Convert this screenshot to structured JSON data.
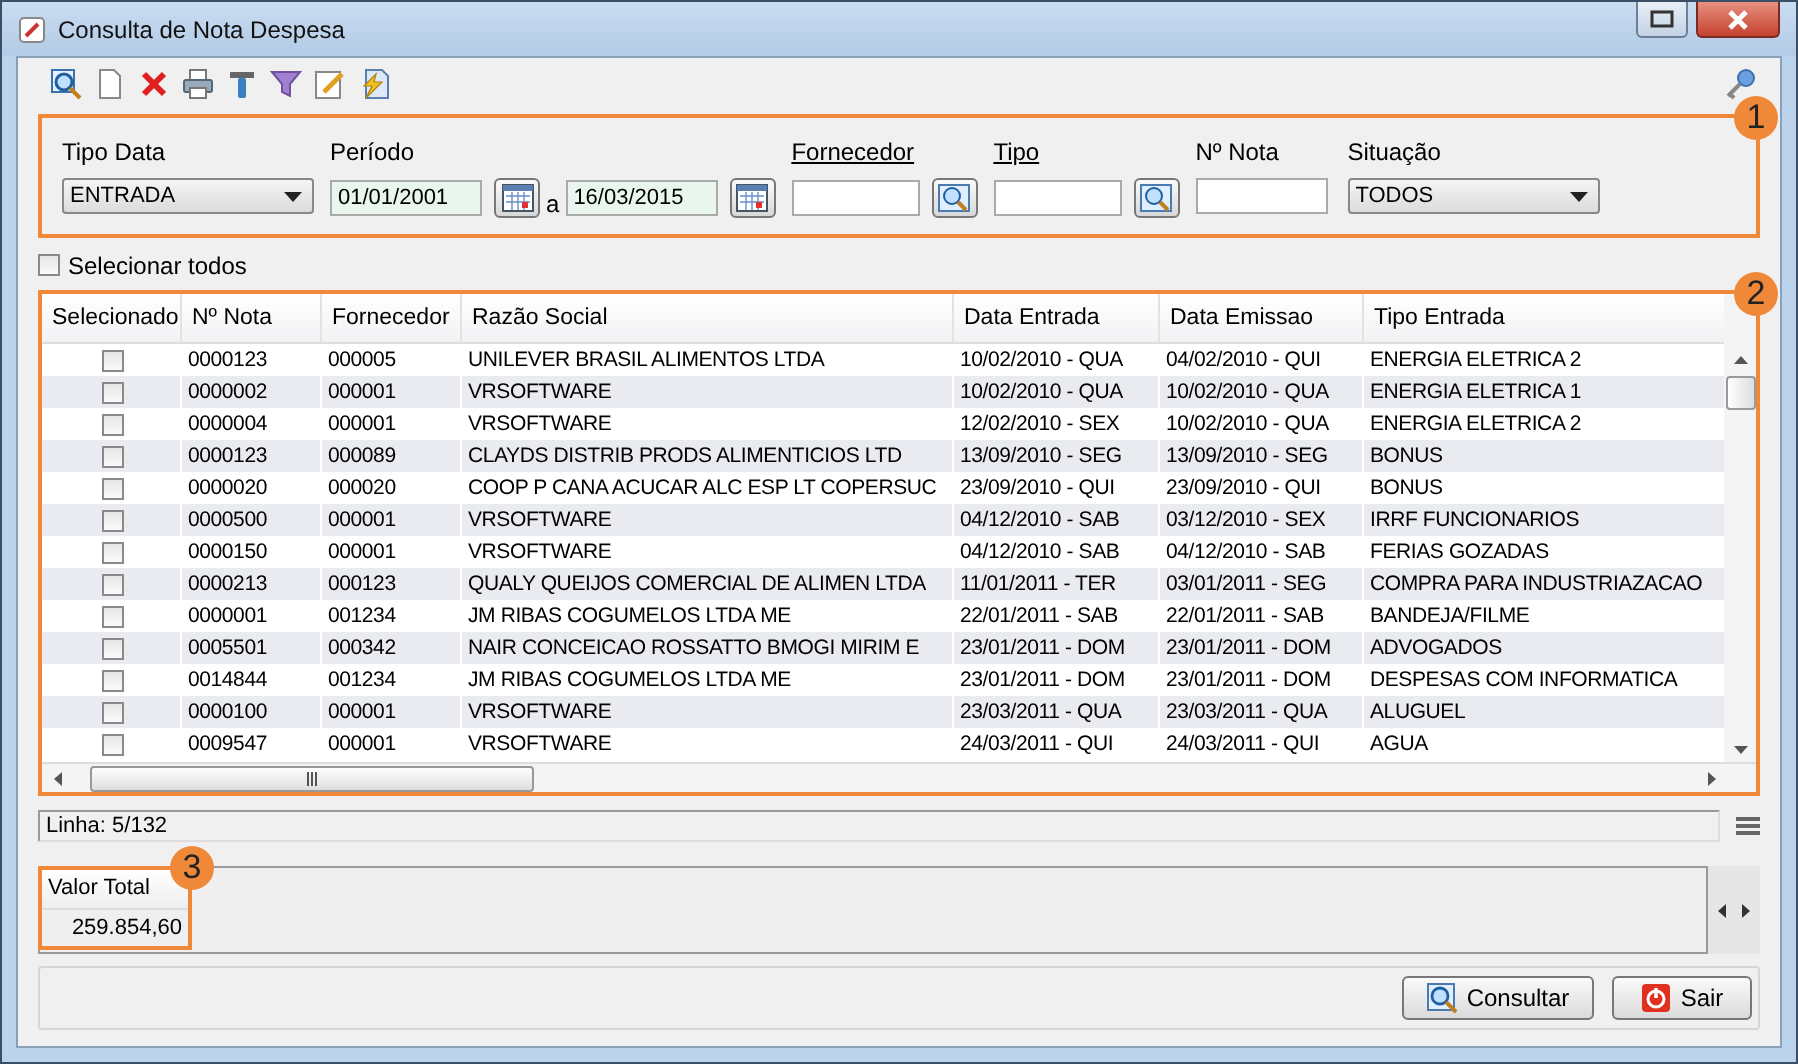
{
  "window": {
    "title": "Consulta de Nota Despesa"
  },
  "toolbar": {
    "tools": [
      {
        "kind": "search"
      },
      {
        "kind": "new"
      },
      {
        "kind": "delete"
      },
      {
        "kind": "print"
      },
      {
        "kind": "tools"
      },
      {
        "kind": "filter"
      },
      {
        "kind": "edit"
      },
      {
        "kind": "export"
      }
    ]
  },
  "filter_panel": {
    "badge": "1",
    "filters": [
      {
        "kind": "select",
        "label": "Tipo Data",
        "value": "ENTRADA"
      },
      {
        "kind": "date-range",
        "label": "Período",
        "from": "01/01/2001",
        "separator": "a",
        "to": "16/03/2015"
      },
      {
        "kind": "lookup",
        "label": "Fornecedor"
      },
      {
        "kind": "lookup",
        "label": "Tipo"
      },
      {
        "kind": "text",
        "label": "Nº Nota"
      },
      {
        "kind": "select",
        "label": "Situação",
        "value": "TODOS"
      }
    ]
  },
  "select_all": {
    "label": "Selecionar todos",
    "checked": false
  },
  "table": {
    "badge": "2",
    "columns": [
      "Selecionado",
      "Nº Nota",
      "Fornecedor",
      "Razão Social",
      "Data Entrada",
      "Data Emissao",
      "Tipo Entrada"
    ],
    "rows": [
      {
        "checked": false,
        "cells": [
          "",
          "0000123",
          "000005",
          "UNILEVER BRASIL ALIMENTOS LTDA",
          "10/02/2010 - QUA",
          "04/02/2010 - QUI",
          "ENERGIA ELETRICA 2"
        ]
      },
      {
        "checked": false,
        "cells": [
          "",
          "0000002",
          "000001",
          "VRSOFTWARE",
          "10/02/2010 - QUA",
          "10/02/2010 - QUA",
          "ENERGIA ELETRICA 1"
        ]
      },
      {
        "checked": false,
        "cells": [
          "",
          "0000004",
          "000001",
          "VRSOFTWARE",
          "12/02/2010 - SEX",
          "10/02/2010 - QUA",
          "ENERGIA ELETRICA 2"
        ]
      },
      {
        "checked": false,
        "cells": [
          "",
          "0000123",
          "000089",
          "CLAYDS DISTRIB PRODS ALIMENTICIOS LTD",
          "13/09/2010 - SEG",
          "13/09/2010 - SEG",
          "BONUS"
        ]
      },
      {
        "checked": false,
        "cells": [
          "",
          "0000020",
          "000020",
          "COOP P CANA ACUCAR ALC ESP LT COPERSUC",
          "23/09/2010 - QUI",
          "23/09/2010 - QUI",
          "BONUS"
        ]
      },
      {
        "checked": false,
        "cells": [
          "",
          "0000500",
          "000001",
          "VRSOFTWARE",
          "04/12/2010 - SAB",
          "03/12/2010 - SEX",
          "IRRF FUNCIONARIOS"
        ]
      },
      {
        "checked": false,
        "cells": [
          "",
          "0000150",
          "000001",
          "VRSOFTWARE",
          "04/12/2010 - SAB",
          "04/12/2010 - SAB",
          "FERIAS GOZADAS"
        ]
      },
      {
        "checked": false,
        "cells": [
          "",
          "0000213",
          "000123",
          "QUALY QUEIJOS COMERCIAL DE ALIMEN LTDA",
          "11/01/2011 - TER",
          "03/01/2011 - SEG",
          "COMPRA PARA INDUSTRIAZACAO"
        ]
      },
      {
        "checked": false,
        "cells": [
          "",
          "0000001",
          "001234",
          "JM RIBAS COGUMELOS LTDA ME",
          "22/01/2011 - SAB",
          "22/01/2011 - SAB",
          "BANDEJA/FILME"
        ]
      },
      {
        "checked": false,
        "cells": [
          "",
          "0005501",
          "000342",
          "NAIR CONCEICAO ROSSATTO BMOGI MIRIM E",
          "23/01/2011 - DOM",
          "23/01/2011 - DOM",
          "ADVOGADOS"
        ]
      },
      {
        "checked": false,
        "cells": [
          "",
          "0014844",
          "001234",
          "JM RIBAS COGUMELOS LTDA ME",
          "23/01/2011 - DOM",
          "23/01/2011 - DOM",
          "DESPESAS COM INFORMATICA"
        ]
      },
      {
        "checked": false,
        "cells": [
          "",
          "0000100",
          "000001",
          "VRSOFTWARE",
          "23/03/2011 - QUA",
          "23/03/2011 - QUA",
          "ALUGUEL"
        ]
      },
      {
        "checked": false,
        "cells": [
          "",
          "0009547",
          "000001",
          "VRSOFTWARE",
          "24/03/2011 - QUI",
          "24/03/2011 - QUI",
          "AGUA"
        ]
      }
    ]
  },
  "status_bar": {
    "text": "Linha: 5/132"
  },
  "totals": {
    "badge": "3",
    "label": "Valor Total",
    "value": "259.854,60"
  },
  "buttons": [
    {
      "kind": "search",
      "label": "Consultar"
    },
    {
      "kind": "exit",
      "label": "Sair"
    }
  ]
}
